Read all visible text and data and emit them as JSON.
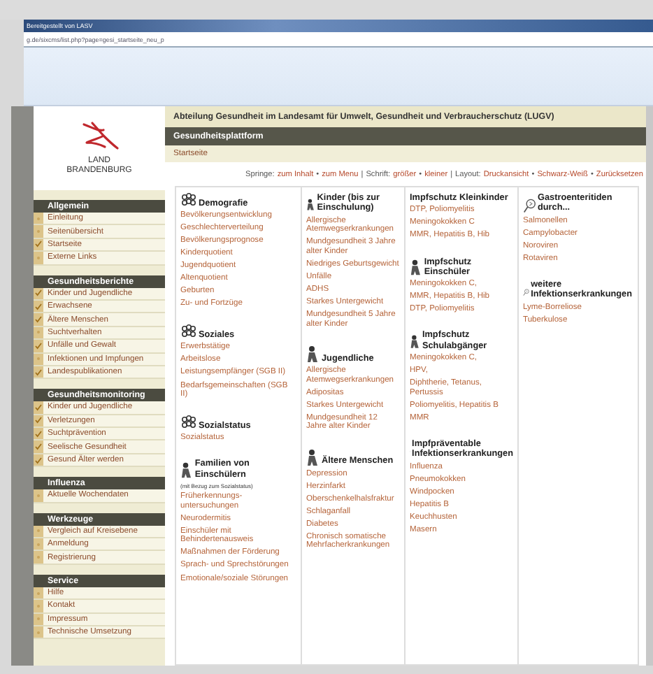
{
  "browser": {
    "title": "Bereitgestellt von LASV",
    "url": "g.de/sixcms/list.php?page=gesi_startseite_neu_p"
  },
  "logo": {
    "line1": "LAND",
    "line2": "BRANDENBURG"
  },
  "sidebar": [
    {
      "title": "Allgemein",
      "items": [
        {
          "label": "Einleitung",
          "checked": false
        },
        {
          "label": "Seitenübersicht",
          "checked": false
        },
        {
          "label": "Startseite",
          "checked": true
        },
        {
          "label": "Externe Links",
          "checked": false
        }
      ]
    },
    {
      "title": "Gesundheitsberichte",
      "items": [
        {
          "label": "Kinder und Jugendliche",
          "checked": true
        },
        {
          "label": "Erwachsene",
          "checked": true
        },
        {
          "label": "Ältere Menschen",
          "checked": true
        },
        {
          "label": "Suchtverhalten",
          "checked": false
        },
        {
          "label": "Unfälle und Gewalt",
          "checked": true
        },
        {
          "label": "Infektionen und Impfungen",
          "checked": false
        },
        {
          "label": "Landespublikationen",
          "checked": true
        }
      ]
    },
    {
      "title": "Gesundheitsmonitoring",
      "items": [
        {
          "label": "Kinder und Jugendliche",
          "checked": true
        },
        {
          "label": "Verletzungen",
          "checked": true
        },
        {
          "label": "Suchtprävention",
          "checked": true
        },
        {
          "label": "Seelische Gesundheit",
          "checked": true
        },
        {
          "label": "Gesund Älter werden",
          "checked": true
        }
      ]
    },
    {
      "title": "Influenza",
      "items": [
        {
          "label": "Aktuelle Wochendaten",
          "checked": false
        }
      ]
    },
    {
      "title": "Werkzeuge",
      "items": [
        {
          "label": "Vergleich auf Kreisebene",
          "checked": false
        },
        {
          "label": "Anmeldung",
          "checked": false
        },
        {
          "label": "Registrierung",
          "checked": false
        }
      ]
    },
    {
      "title": "Service",
      "items": [
        {
          "label": "Hilfe",
          "checked": false
        },
        {
          "label": "Kontakt",
          "checked": false
        },
        {
          "label": "Impressum",
          "checked": false
        },
        {
          "label": "Technische Umsetzung",
          "checked": false
        }
      ]
    }
  ],
  "header": {
    "department": "Abteilung Gesundheit im Landesamt für Umwelt, Gesundheit und Verbraucherschutz (LUGV)",
    "platform": "Gesundheitsplattform",
    "breadcrumb": "Startseite"
  },
  "jump_bar": {
    "separator": "•",
    "divider": "|",
    "groups": [
      {
        "label": "Springe:",
        "links": [
          "zum Inhalt",
          "zum Menu"
        ]
      },
      {
        "label": "Schrift:",
        "links": [
          "größer",
          "kleiner"
        ]
      },
      {
        "label": "Layout:",
        "links": [
          "Druckansicht",
          "Schwarz-Weiß",
          "Zurücksetzen"
        ]
      }
    ]
  },
  "columns": [
    [
      {
        "kind": "group",
        "title": "Demografie",
        "links": [
          "Bevölkerungsentwicklung",
          "Geschlechterverteilung",
          "Bevölkerungsprognose",
          "Kinderquotient",
          "Jugendquotient",
          "Altenquotient",
          "Geburten",
          "Zu- und Fortzüge"
        ]
      },
      {
        "kind": "group",
        "title": "Soziales",
        "links": [
          "Erwerbstätige",
          "Arbeitslose",
          "Leistungsempfänger (SGB II)",
          "Bedarfsgemeinschaften (SGB II)"
        ]
      },
      {
        "kind": "group",
        "title": "Sozialstatus",
        "links": [
          "Sozialstatus"
        ]
      },
      {
        "kind": "person",
        "title": "Familien von Einschülern",
        "note": "(mit Bezug zum Sozialstatus)",
        "links": [
          "Früherkennungs-untersuchungen",
          "Neurodermitis",
          "Einschüler mit Behindertenausweis",
          "Maßnahmen der Förderung",
          "Sprach- und Sprechstörungen",
          "Emotionale/soziale Störungen"
        ]
      }
    ],
    [
      {
        "kind": "person",
        "title": "Kinder (bis zur Einschulung)",
        "links": [
          "Allergische Atemwegserkrankungen",
          "Mundgesundheit 3 Jahre alter Kinder",
          "Niedriges Geburtsgewicht",
          "Unfälle",
          "ADHS",
          "Starkes Untergewicht",
          "Mundgesundheit 5 Jahre alter Kinder"
        ]
      },
      {
        "kind": "person",
        "title": "Jugendliche",
        "links": [
          "Allergische Atemwegserkrankungen",
          "Adipositas",
          "Starkes Untergewicht",
          "Mundgesundheit 12 Jahre alter Kinder"
        ]
      },
      {
        "kind": "person",
        "title": "Ältere Menschen",
        "links": [
          "Depression",
          "Herzinfarkt",
          "Oberschenkelhalsfraktur",
          "Schlaganfall",
          "Diabetes",
          "Chronisch somatische Mehrfacherkrankungen"
        ]
      }
    ],
    [
      {
        "kind": "plain",
        "title": "Impfschutz Kleinkinder",
        "links": [
          "DTP, Poliomyelitis",
          "Meningokokken C",
          "MMR, Hepatitis B, Hib"
        ]
      },
      {
        "kind": "person",
        "title": "Impfschutz Einschüler",
        "links": [
          "Meningokokken C,",
          "MMR, Hepatitis B, Hib",
          "DTP, Poliomyelitis"
        ]
      },
      {
        "kind": "person",
        "title": "Impfschutz Schulabgänger",
        "links": [
          "Meningokokken C,",
          "HPV,",
          "Diphtherie, Tetanus, Pertussis",
          "Poliomyelitis, Hepatitis B",
          "MMR"
        ]
      },
      {
        "kind": "magnifier",
        "title": "Impfpräventable Infektionserkrankungen",
        "links": [
          "Influenza",
          "Pneumokokken",
          "Windpocken",
          "Hepatitis B",
          "Keuchhusten",
          "Masern"
        ]
      }
    ],
    [
      {
        "kind": "magnifier",
        "title": "Gastroenteritiden durch...",
        "links": [
          "Salmonellen",
          "Campylobacter",
          "Noroviren",
          "Rotaviren"
        ]
      },
      {
        "kind": "magnifier",
        "title": "weitere Infektionserkrankungen",
        "links": [
          "Lyme-Borreliose",
          "Tuberkulose"
        ]
      }
    ]
  ]
}
